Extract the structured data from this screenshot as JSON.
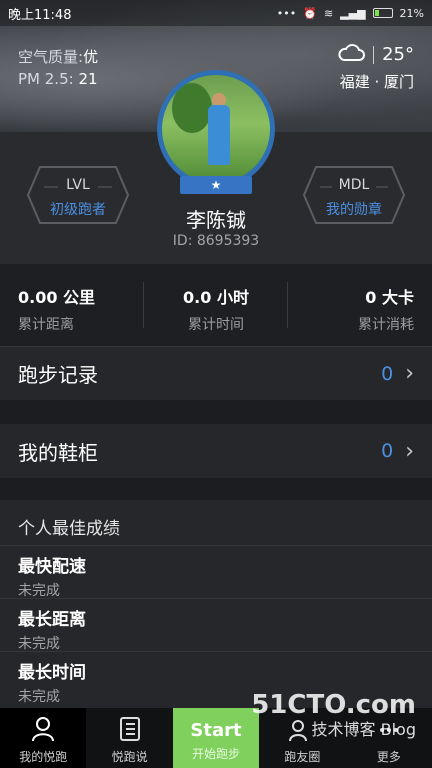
{
  "status_bar": {
    "time": "晚上11:48",
    "battery": "21%"
  },
  "air": {
    "quality_label": "空气质量:",
    "quality_value": "优",
    "pm_label": "PM 2.5:",
    "pm_value": "21"
  },
  "weather": {
    "temp": "25°",
    "location": "福建 · 厦门"
  },
  "profile": {
    "lvl_label": "LVL",
    "lvl_value": "初级跑者",
    "mdl_label": "MDL",
    "mdl_value": "我的勋章",
    "name": "李陈铖",
    "id": "ID: 8695393",
    "badge": "★"
  },
  "stats": [
    {
      "value": "0.00 公里",
      "caption": "累计距离"
    },
    {
      "value": "0.0 小时",
      "caption": "累计时间"
    },
    {
      "value": "0 大卡",
      "caption": "累计消耗"
    }
  ],
  "records": {
    "title": "跑步记录",
    "count": "0"
  },
  "shoes": {
    "title": "我的鞋柜",
    "count": "0"
  },
  "best": {
    "title": "个人最佳成绩",
    "items": [
      {
        "title": "最快配速",
        "status": "未完成"
      },
      {
        "title": "最长距离",
        "status": "未完成"
      },
      {
        "title": "最长时间",
        "status": "未完成"
      }
    ]
  },
  "tabs": {
    "mine": "我的悦跑",
    "talk": "悦跑说",
    "start_big": "Start",
    "start": "开始跑步",
    "circle": "跑友圈",
    "more": "更多"
  },
  "watermark": {
    "line1": "51CTO.com",
    "line2": "技术博客 Blog"
  },
  "colors": {
    "accent": "#4a90e2",
    "start": "#7fd05c"
  }
}
